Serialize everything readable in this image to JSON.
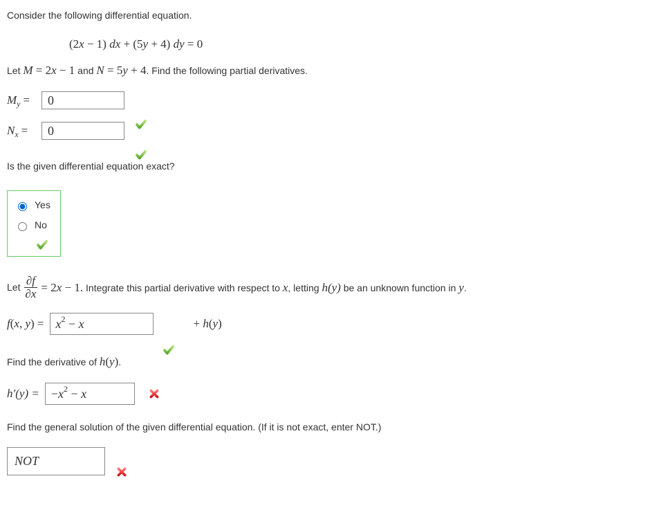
{
  "q1": {
    "intro": "Consider the following differential equation.",
    "equation": "(2x − 1) dx + (5y + 4) dy = 0",
    "setup_pre": "Let ",
    "setup_M": "M = 2x − 1",
    "setup_and": " and ",
    "setup_N": "N = 5y + 4",
    "setup_post": ". Find the following partial derivatives."
  },
  "my": {
    "label_base": "M",
    "label_sub": "y",
    "eq": " = ",
    "value": "0",
    "correct": true
  },
  "nx": {
    "label_base": "N",
    "label_sub": "x",
    "eq": " = ",
    "value": "0",
    "correct": true
  },
  "exact": {
    "prompt": "Is the given differential equation exact?",
    "yes": "Yes",
    "no": "No",
    "selected": "yes",
    "correct": true
  },
  "integrate": {
    "pre": "Let ",
    "frac_num": "∂f",
    "frac_den": "∂x",
    "rhs": " = 2x − 1. Integrate this partial derivative with respect to x, letting ",
    "hy": "h(y)",
    "post": " be an unknown function in y.",
    "fxy_label": "f(x, y) = ",
    "fxy_value_pre": "x",
    "fxy_value_sup": "2",
    "fxy_value_post": " − x",
    "plus_hy": " + h(y)",
    "correct": true
  },
  "hprime": {
    "prompt": "Find the derivative of h(y).",
    "label": "h′(y) = ",
    "value_pre": "−x",
    "value_sup": "2",
    "value_post": " − x",
    "correct": false
  },
  "general": {
    "prompt": "Find the general solution of the given differential equation. (If it is not exact, enter NOT.)",
    "value": "NOT",
    "correct": false
  }
}
